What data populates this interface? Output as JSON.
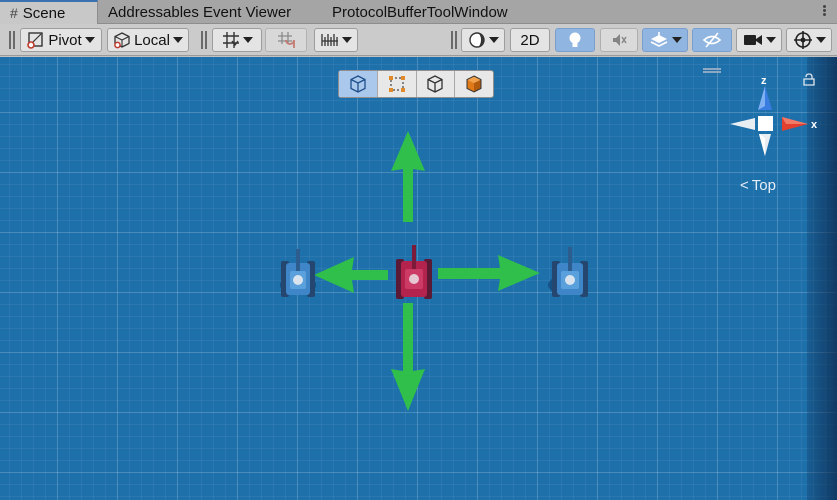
{
  "tabs": [
    {
      "label": "Scene",
      "icon": "scene-grid-icon",
      "active": true
    },
    {
      "label": "Addressables Event Viewer",
      "active": false
    },
    {
      "label": "ProtocolBufferToolWindow",
      "active": false
    }
  ],
  "toolbar": {
    "pivot_label": "Pivot",
    "local_label": "Local",
    "mode_2d_label": "2D",
    "icons": [
      "grid-snap-icon",
      "increment-snap-icon",
      "ruler-icon",
      "shading-mode-icon",
      "lighting-icon",
      "audio-icon",
      "effects-icon",
      "hidden-objects-icon",
      "camera-icon",
      "gizmos-icon"
    ]
  },
  "draw_modes": [
    "wireframe-cube-icon",
    "rect-tool-icon",
    "outline-cube-icon",
    "shaded-cube-icon"
  ],
  "gizmo": {
    "axis_z": "z",
    "axis_x": "x",
    "view_label": "Top"
  },
  "colors": {
    "scene_bg": "#1e70ab",
    "arrow_green": "#2fbf4a",
    "axis_x": "#e0402d",
    "axis_z": "#3a7de0",
    "tank_blue": "#3f86c8",
    "tank_red": "#b3234d"
  }
}
